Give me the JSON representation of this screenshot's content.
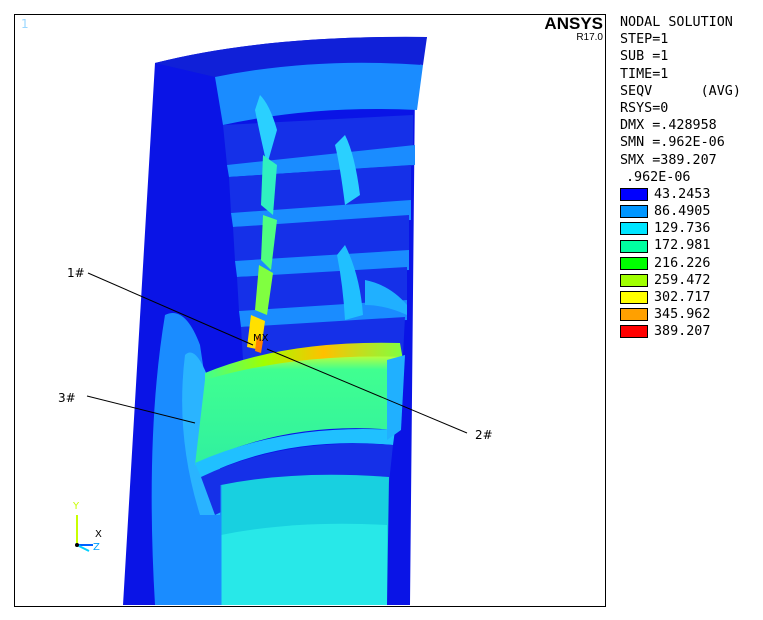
{
  "viewport": {
    "window_number": "1",
    "brand": "ANSYS",
    "version": "R17.0",
    "max_marker": "MX",
    "callouts": {
      "c1": "1#",
      "c2": "2#",
      "c3": "3#"
    },
    "triad": {
      "y": "Y",
      "x": "X",
      "z": "Z"
    }
  },
  "legend": {
    "lines": [
      "NODAL SOLUTION",
      "STEP=1",
      "SUB =1",
      "TIME=1",
      "SEQV      (AVG)",
      "RSYS=0",
      "DMX =.428958",
      "SMN =.962E-06",
      "SMX =389.207"
    ],
    "min_value": ".962E-06",
    "bands": [
      {
        "value": "43.2453",
        "color": "#0000ff"
      },
      {
        "value": "86.4905",
        "color": "#0096ff"
      },
      {
        "value": "129.736",
        "color": "#00e5ff"
      },
      {
        "value": "172.981",
        "color": "#00ffa0"
      },
      {
        "value": "216.226",
        "color": "#00ff00"
      },
      {
        "value": "259.472",
        "color": "#a0ff00"
      },
      {
        "value": "302.717",
        "color": "#ffff00"
      },
      {
        "value": "345.962",
        "color": "#ffa000"
      },
      {
        "value": "389.207",
        "color": "#ff0000"
      }
    ]
  }
}
